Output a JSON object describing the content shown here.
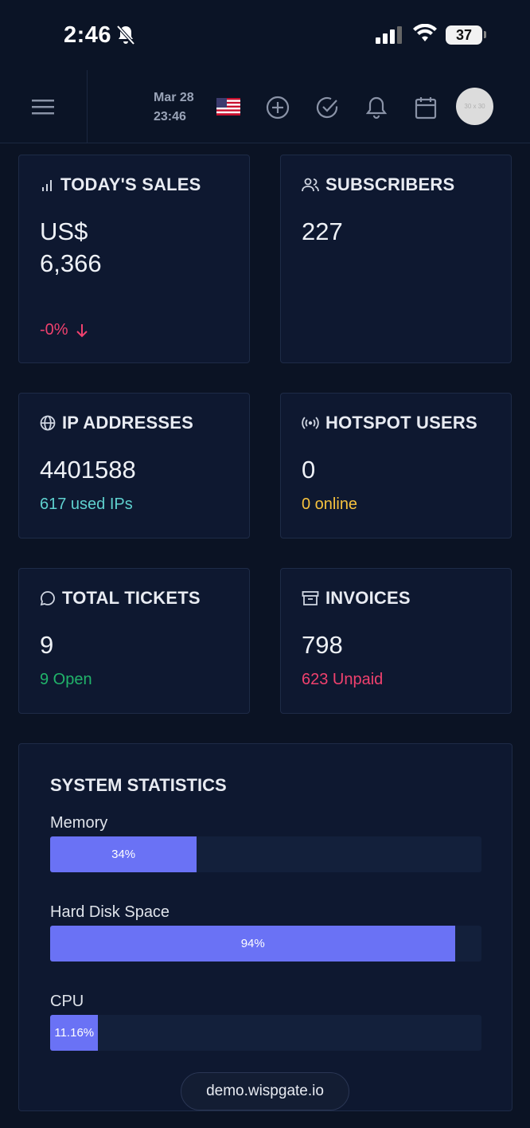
{
  "status_bar": {
    "time": "2:46",
    "battery": "37",
    "icons": [
      "bell-slash-icon",
      "signal-icon",
      "wifi-icon",
      "battery-icon"
    ]
  },
  "topnav": {
    "date": "Mar 28",
    "clock": "23:46",
    "avatar_text": "30 x 30",
    "icons": [
      "hamburger-icon",
      "us-flag-icon",
      "plus-circle-icon",
      "check-circle-icon",
      "bell-icon",
      "calendar-icon"
    ]
  },
  "cards": {
    "sales": {
      "title": "TODAY'S SALES",
      "currency": "US$",
      "value": "6,366",
      "change": "-0%",
      "icon": "bar-chart-icon"
    },
    "subscribers": {
      "title": "SUBSCRIBERS",
      "value": "227",
      "icon": "users-icon"
    },
    "ip": {
      "title": "IP ADDRESSES",
      "value": "4401588",
      "sub": "617 used IPs",
      "icon": "globe-icon"
    },
    "hotspot": {
      "title": "HOTSPOT USERS",
      "value": "0",
      "sub": "0 online",
      "icon": "broadcast-icon"
    },
    "tickets": {
      "title": "TOTAL TICKETS",
      "value": "9",
      "sub": "9 Open",
      "icon": "chat-bubble-icon"
    },
    "invoices": {
      "title": "INVOICES",
      "value": "798",
      "sub": "623 Unpaid",
      "icon": "archive-icon"
    }
  },
  "colors": {
    "accent": "#6a72f5",
    "danger": "#f0416e",
    "success": "#21b36a",
    "warning": "#f6c23e",
    "teal": "#5fd1cf"
  },
  "system_stats": {
    "title": "SYSTEM STATISTICS",
    "items": [
      {
        "label": "Memory",
        "percent": 34,
        "text": "34%"
      },
      {
        "label": "Hard Disk Space",
        "percent": 94,
        "text": "94%"
      },
      {
        "label": "CPU",
        "percent": 11.16,
        "text": "11.16%"
      }
    ]
  },
  "url": "demo.wispgate.io"
}
